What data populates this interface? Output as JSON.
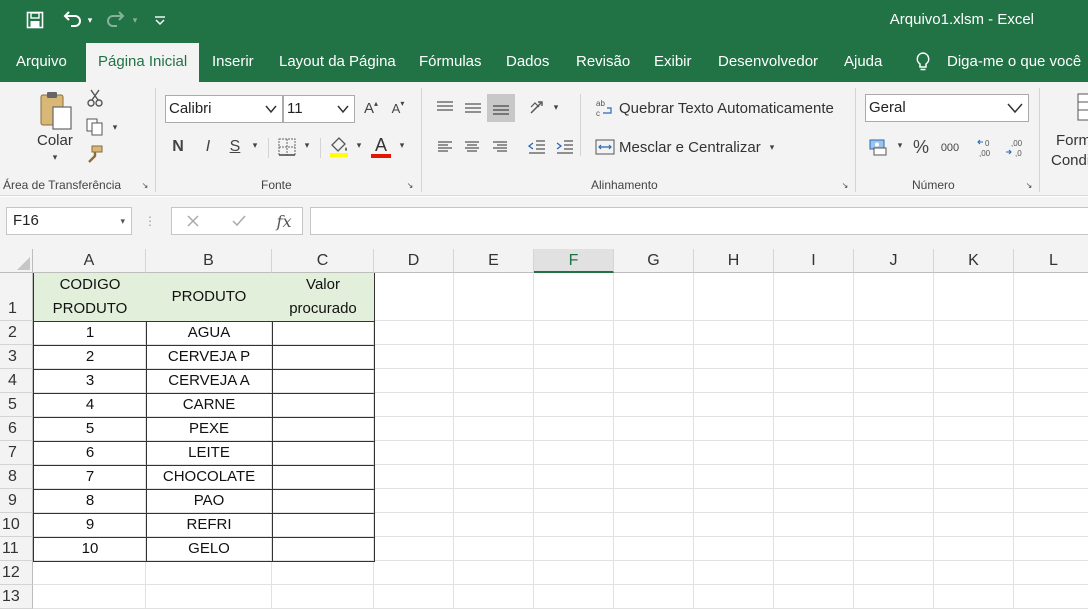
{
  "titlebar": {
    "title": "Arquivo1.xlsm  -  Excel",
    "icons": [
      "save-icon",
      "undo-icon",
      "redo-icon",
      "customize-qat-icon"
    ]
  },
  "tabs": [
    {
      "label": "Arquivo"
    },
    {
      "label": "Página Inicial",
      "active": true
    },
    {
      "label": "Inserir"
    },
    {
      "label": "Layout da Página"
    },
    {
      "label": "Fórmulas"
    },
    {
      "label": "Dados"
    },
    {
      "label": "Revisão"
    },
    {
      "label": "Exibir"
    },
    {
      "label": "Desenvolvedor"
    },
    {
      "label": "Ajuda"
    },
    {
      "label": "Diga-me o que você"
    }
  ],
  "ribbon": {
    "clipboard": {
      "paste_label": "Colar",
      "group_label": "Área de Transferência"
    },
    "font": {
      "name": "Calibri",
      "size": "11",
      "bold": "N",
      "italic": "I",
      "underline": "S",
      "color_letter": "A",
      "group_label": "Fonte",
      "font_color": "#e51400"
    },
    "alignment": {
      "wrap_label": "Quebrar Texto Automaticamente",
      "merge_label": "Mesclar e Centralizar",
      "group_label": "Alinhamento"
    },
    "number": {
      "format": "Geral",
      "percent": "%",
      "thousands": "000",
      "group_label": "Número"
    },
    "styles": {
      "cond_line1": "Form",
      "cond_line2": "Condi"
    }
  },
  "formula_bar": {
    "name_box": "F16",
    "fx": "fx",
    "formula": ""
  },
  "columns": [
    "A",
    "B",
    "C",
    "D",
    "E",
    "F",
    "G",
    "H",
    "I",
    "J",
    "K",
    "L"
  ],
  "rows": [
    "1",
    "2",
    "3",
    "4",
    "5",
    "6",
    "7",
    "8",
    "9",
    "10",
    "11",
    "12",
    "13"
  ],
  "table": {
    "headers": {
      "codigo_line1": "CODIGO",
      "codigo_line2": "PRODUTO",
      "produto": "PRODUTO",
      "valor_line1": "Valor",
      "valor_line2": "procurado"
    },
    "data": [
      {
        "codigo": "1",
        "produto": "AGUA"
      },
      {
        "codigo": "2",
        "produto": "CERVEJA P"
      },
      {
        "codigo": "3",
        "produto": "CERVEJA A"
      },
      {
        "codigo": "4",
        "produto": "CARNE"
      },
      {
        "codigo": "5",
        "produto": "PEXE"
      },
      {
        "codigo": "6",
        "produto": "LEITE"
      },
      {
        "codigo": "7",
        "produto": "CHOCOLATE"
      },
      {
        "codigo": "8",
        "produto": "PAO"
      },
      {
        "codigo": "9",
        "produto": "REFRI"
      },
      {
        "codigo": "10",
        "produto": "GELO"
      }
    ]
  },
  "colors": {
    "excel_green": "#217346",
    "header_fill": "#e2efda"
  }
}
